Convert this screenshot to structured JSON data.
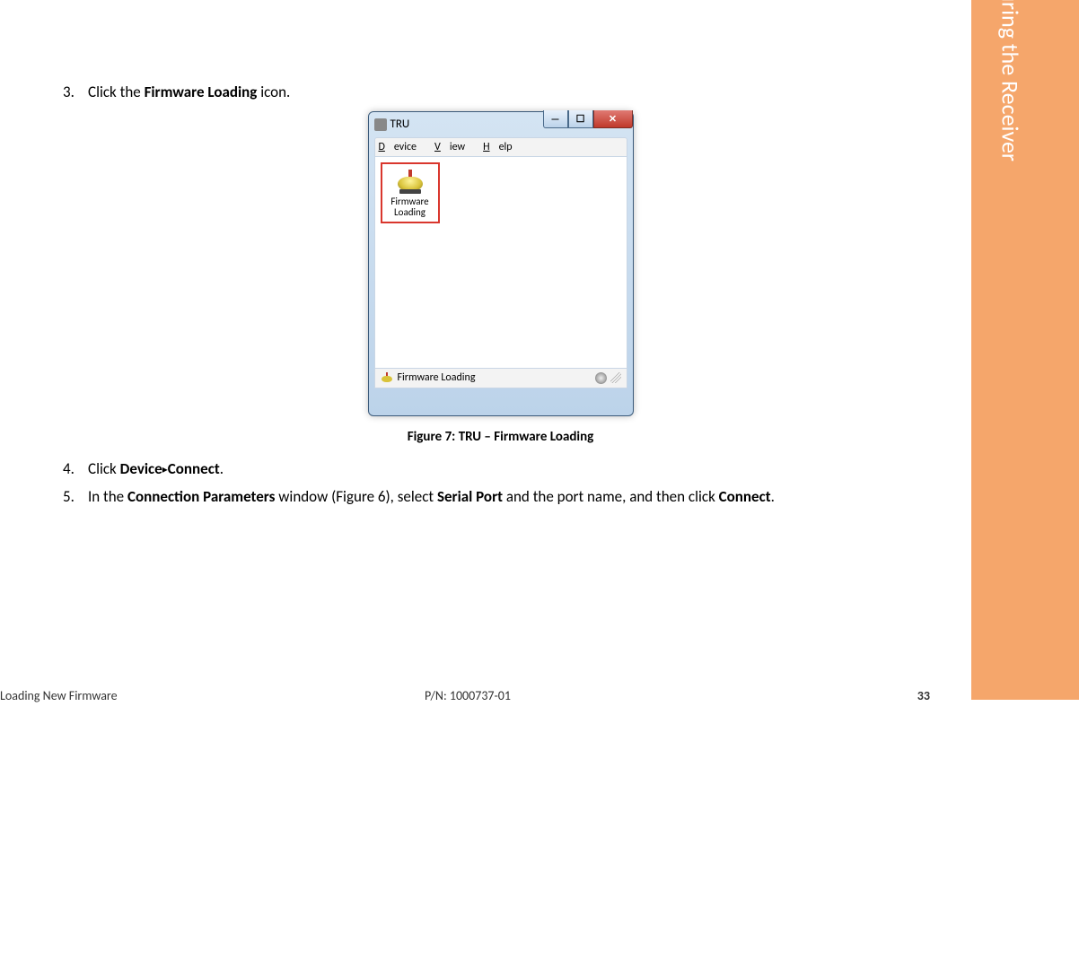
{
  "section_tab": "Configuring the Receiver",
  "steps": [
    {
      "num": "3.",
      "parts": [
        "Click the ",
        "Firmware Loading",
        " icon."
      ]
    },
    {
      "num": "4.",
      "parts": [
        "Click ",
        "Device",
        " ▸ ",
        "Connect",
        "."
      ]
    },
    {
      "num": "5.",
      "parts": [
        "In the ",
        "Connection Parameters",
        " window (Figure 6), select ",
        "Serial Port",
        " and the port name, and then click ",
        "Connect",
        "."
      ]
    }
  ],
  "figure": {
    "caption": "Figure 7: TRU – Firmware Loading",
    "window": {
      "title": "TRU",
      "menus": {
        "device": "Device",
        "view": "View",
        "help": "Help"
      },
      "icon_label_line1": "Firmware",
      "icon_label_line2": "Loading",
      "status_text": "Firmware Loading"
    }
  },
  "footer": {
    "left": "Loading New Firmware",
    "center": "P/N: 1000737-01",
    "page": "33"
  },
  "glyphs": {
    "triangle": "▸",
    "min": "—",
    "max": "☐",
    "close": "✕"
  }
}
